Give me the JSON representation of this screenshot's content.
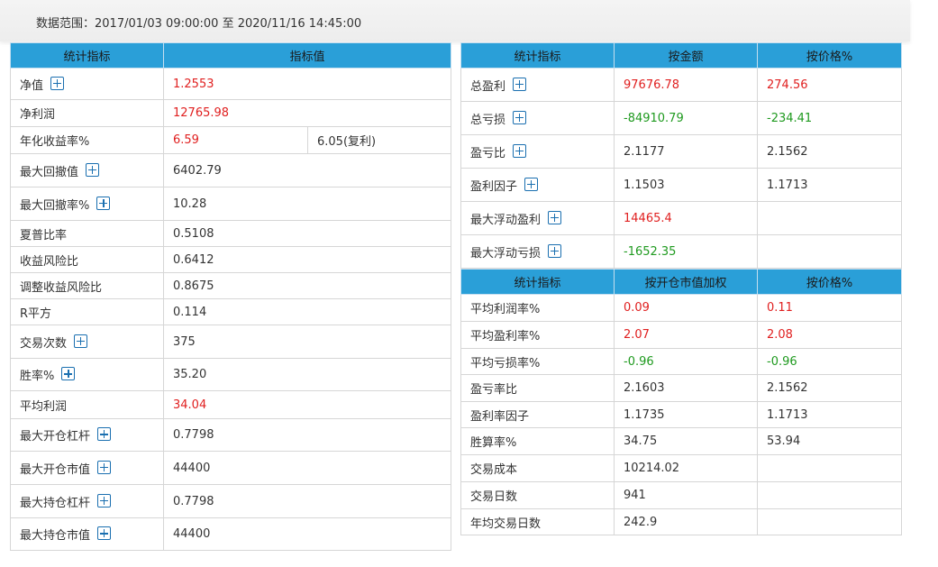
{
  "header": {
    "range_text": "数据范围：2017/01/03 09:00:00 至 2020/11/16 14:45:00"
  },
  "left_table": {
    "headers": [
      "统计指标",
      "指标值"
    ],
    "rows": [
      {
        "label": "净值",
        "value": "1.2553",
        "color": "red",
        "expand": true
      },
      {
        "label": "净利润",
        "value": "12765.98",
        "color": "red",
        "expand": false
      },
      {
        "label": "年化收益率%",
        "value": "6.59",
        "color": "red",
        "expand": false,
        "extra": "6.05(复利)"
      },
      {
        "label": "最大回撤值",
        "value": "6402.79",
        "color": "",
        "expand": true
      },
      {
        "label": "最大回撤率%",
        "value": "10.28",
        "color": "",
        "expand": true
      },
      {
        "label": "夏普比率",
        "value": "0.5108",
        "color": "",
        "expand": false
      },
      {
        "label": "收益风险比",
        "value": "0.6412",
        "color": "",
        "expand": false
      },
      {
        "label": "调整收益风险比",
        "value": "0.8675",
        "color": "",
        "expand": false
      },
      {
        "label": "R平方",
        "value": "0.114",
        "color": "",
        "expand": false
      },
      {
        "label": "交易次数",
        "value": "375",
        "color": "",
        "expand": true
      },
      {
        "label": "胜率%",
        "value": "35.20",
        "color": "",
        "expand": true
      },
      {
        "label": "平均利润",
        "value": "34.04",
        "color": "red",
        "expand": false
      },
      {
        "label": "最大开仓杠杆",
        "value": "0.7798",
        "color": "",
        "expand": true
      },
      {
        "label": "最大开仓市值",
        "value": "44400",
        "color": "",
        "expand": true
      },
      {
        "label": "最大持仓杠杆",
        "value": "0.7798",
        "color": "",
        "expand": true
      },
      {
        "label": "最大持仓市值",
        "value": "44400",
        "color": "",
        "expand": true
      }
    ]
  },
  "right_top_table": {
    "headers": [
      "统计指标",
      "按金额",
      "按价格%"
    ],
    "rows": [
      {
        "label": "总盈利",
        "v1": "97676.78",
        "c1": "red",
        "v2": "274.56",
        "c2": "red",
        "expand": true
      },
      {
        "label": "总亏损",
        "v1": "-84910.79",
        "c1": "green",
        "v2": "-234.41",
        "c2": "green",
        "expand": true
      },
      {
        "label": "盈亏比",
        "v1": "2.1177",
        "c1": "",
        "v2": "2.1562",
        "c2": "",
        "expand": true
      },
      {
        "label": "盈利因子",
        "v1": "1.1503",
        "c1": "",
        "v2": "1.1713",
        "c2": "",
        "expand": true
      },
      {
        "label": "最大浮动盈利",
        "v1": "14465.4",
        "c1": "red",
        "v2": "",
        "c2": "",
        "expand": true
      },
      {
        "label": "最大浮动亏损",
        "v1": "-1652.35",
        "c1": "green",
        "v2": "",
        "c2": "",
        "expand": true
      }
    ]
  },
  "right_bottom_table": {
    "headers": [
      "统计指标",
      "按开仓市值加权",
      "按价格%"
    ],
    "rows": [
      {
        "label": "平均利润率%",
        "v1": "0.09",
        "c1": "red",
        "v2": "0.11",
        "c2": "red"
      },
      {
        "label": "平均盈利率%",
        "v1": "2.07",
        "c1": "red",
        "v2": "2.08",
        "c2": "red"
      },
      {
        "label": "平均亏损率%",
        "v1": "-0.96",
        "c1": "green",
        "v2": "-0.96",
        "c2": "green"
      },
      {
        "label": "盈亏率比",
        "v1": "2.1603",
        "c1": "",
        "v2": "2.1562",
        "c2": ""
      },
      {
        "label": "盈利率因子",
        "v1": "1.1735",
        "c1": "",
        "v2": "1.1713",
        "c2": ""
      },
      {
        "label": "胜算率%",
        "v1": "34.75",
        "c1": "",
        "v2": "53.94",
        "c2": ""
      },
      {
        "label": "交易成本",
        "v1": "10214.02",
        "c1": "",
        "v2": "",
        "c2": ""
      },
      {
        "label": "交易日数",
        "v1": "941",
        "c1": "",
        "v2": "",
        "c2": ""
      },
      {
        "label": "年均交易日数",
        "v1": "242.9",
        "c1": "",
        "v2": "",
        "c2": ""
      }
    ]
  }
}
